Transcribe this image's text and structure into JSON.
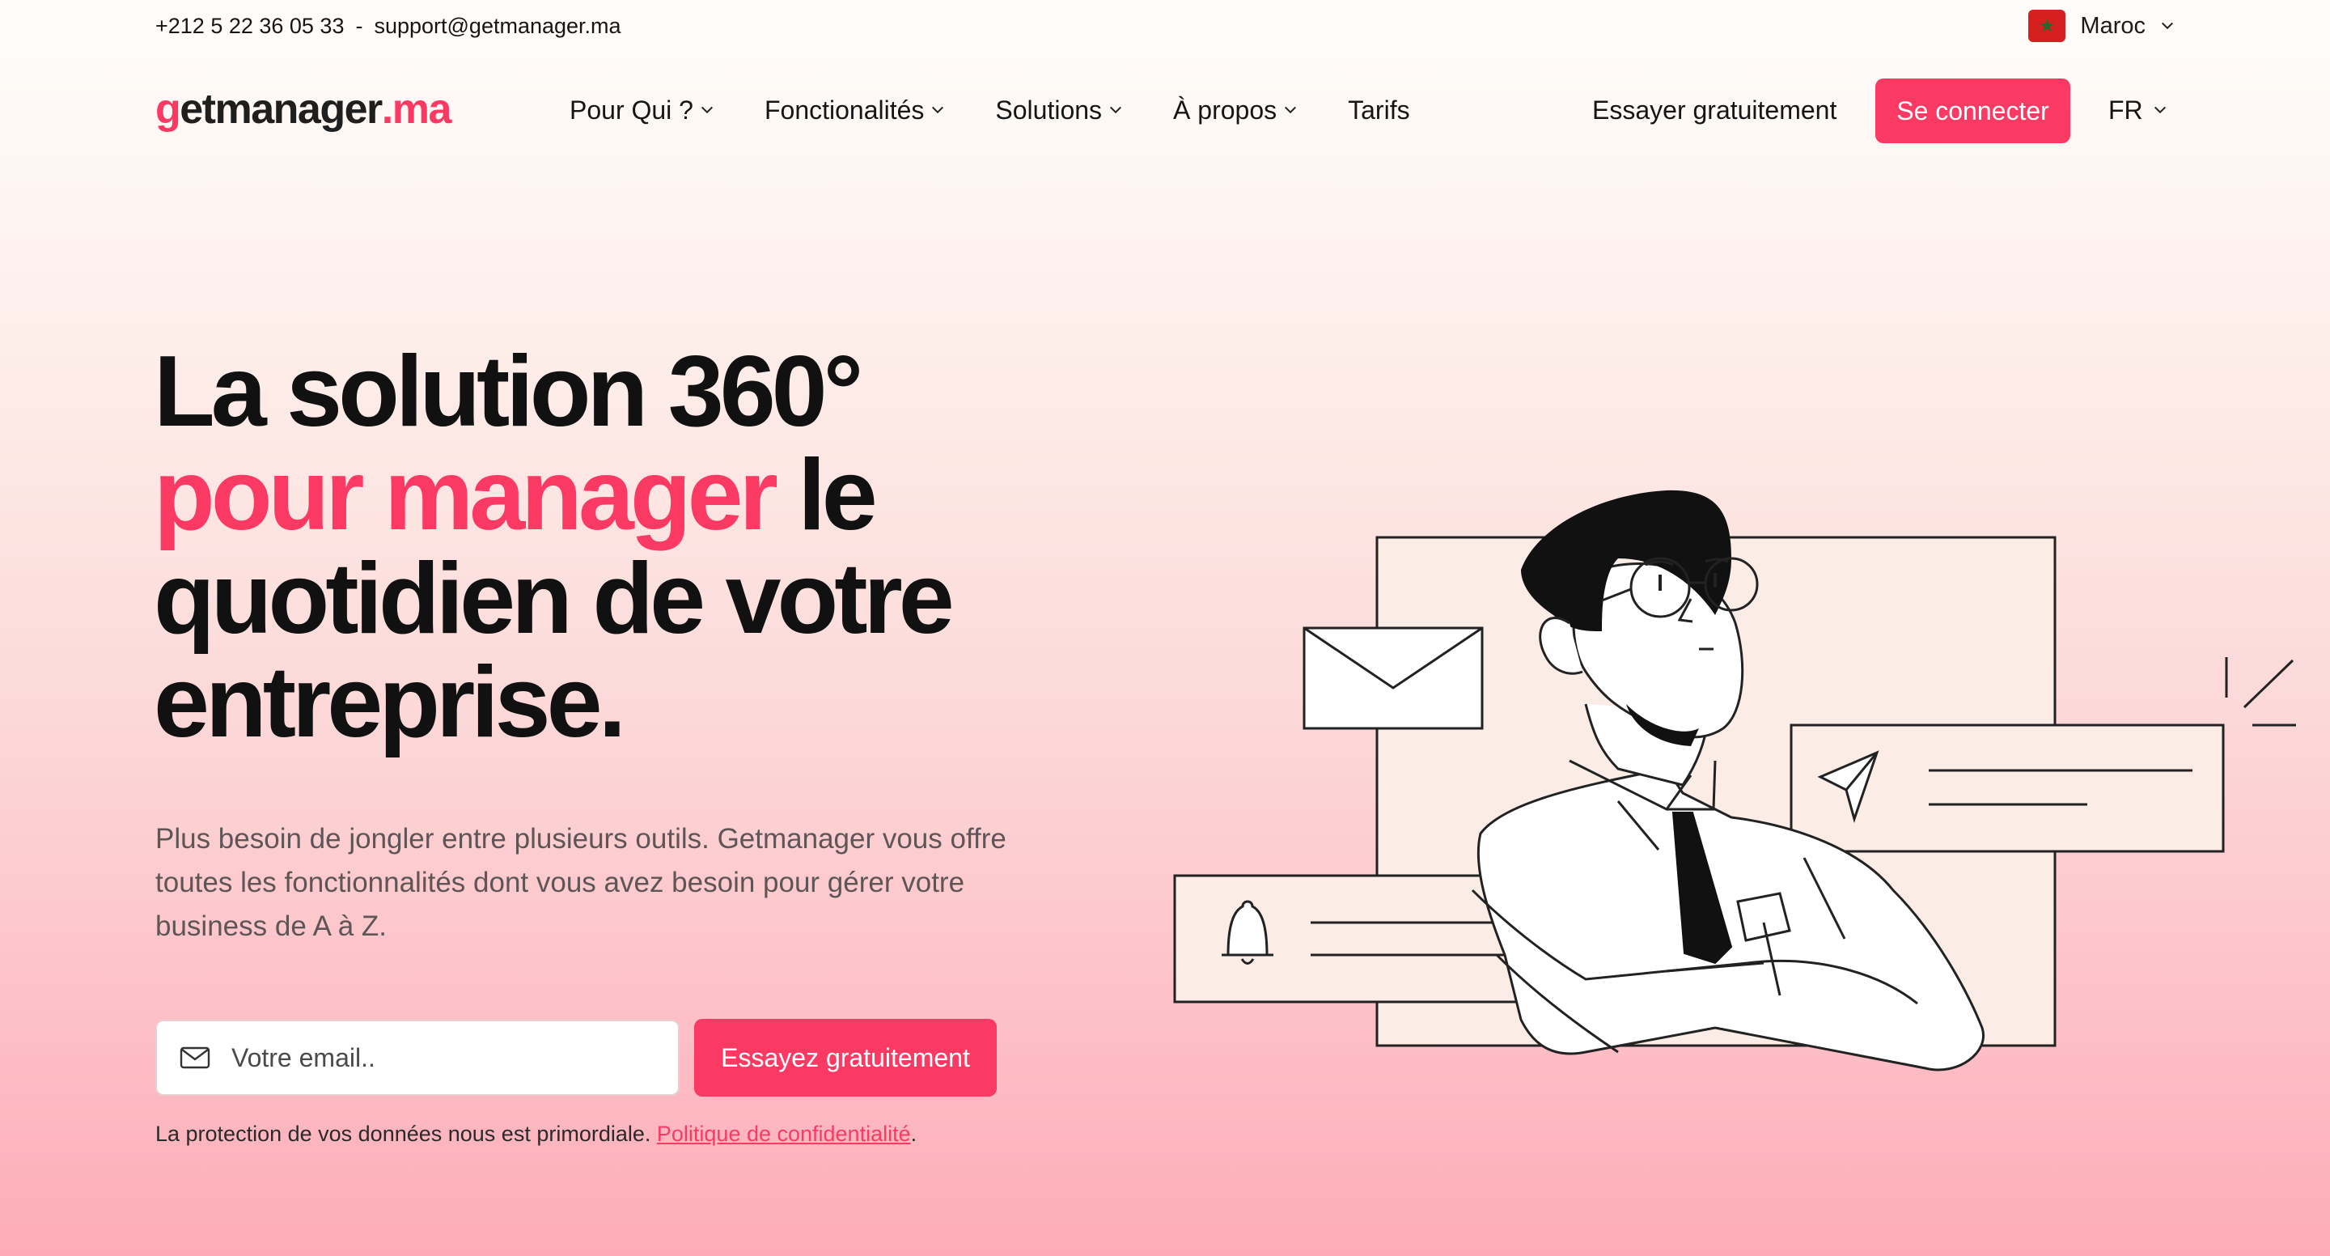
{
  "topbar": {
    "phone": "+212 5 22 36 05 33",
    "separator": "-",
    "email": "support@getmanager.ma",
    "country": "Maroc"
  },
  "brand": {
    "logo_g": "g",
    "logo_mid": "etmanager",
    "logo_tld": ".ma",
    "accent_color": "#fb3a64"
  },
  "nav": {
    "items": [
      {
        "label": "Pour Qui ?",
        "has_dropdown": true
      },
      {
        "label": "Fonctionalités",
        "has_dropdown": true
      },
      {
        "label": "Solutions",
        "has_dropdown": true
      },
      {
        "label": "À propos",
        "has_dropdown": true
      },
      {
        "label": "Tarifs",
        "has_dropdown": false
      }
    ],
    "try_free": "Essayer gratuitement",
    "login": "Se connecter",
    "language": "FR"
  },
  "hero": {
    "title_line1": "La solution 360°",
    "title_accent": "pour manager",
    "title_rest": " le quotidien de votre entreprise.",
    "subtitle": "Plus besoin de jongler entre plusieurs outils. Getmanager vous offre toutes les fonctionnalités dont vous avez besoin pour gérer votre business de A à Z.",
    "email_placeholder": "Votre email..",
    "cta": "Essayez gratuitement",
    "privacy_text": "La protection de vos données nous est primordiale. ",
    "privacy_link": "Politique de confidentialité",
    "privacy_end": "."
  },
  "icons": {
    "flag": "morocco-flag-icon",
    "chevron": "chevron-down-icon",
    "mail": "mail-icon",
    "envelope": "envelope-icon",
    "bell": "bell-icon",
    "send": "paper-plane-icon"
  }
}
